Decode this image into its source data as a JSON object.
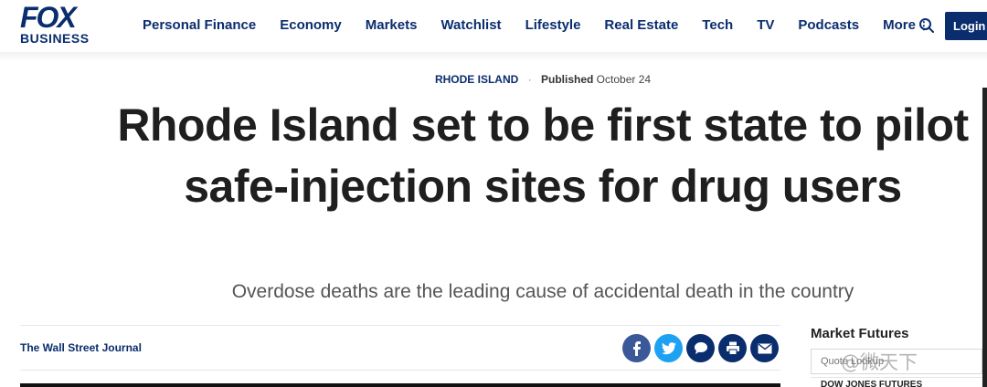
{
  "header": {
    "logo": {
      "top": "FOX",
      "bottom": "BUSINESS"
    },
    "nav": [
      "Personal Finance",
      "Economy",
      "Markets",
      "Watchlist",
      "Lifestyle",
      "Real Estate",
      "Tech",
      "TV",
      "Podcasts"
    ],
    "more_label": "More",
    "login_label": "Login",
    "icons": {
      "search": "search-icon",
      "more": "kebab-icon"
    }
  },
  "article": {
    "section": "RHODE ISLAND",
    "published_label": "Published",
    "published_date": "October 24",
    "headline": "Rhode Island set to be first state to pilot safe-injection sites for drug users",
    "subhead": "Overdose deaths are the leading cause of accidental death in the country",
    "source": "The Wall Street Journal",
    "share_icons": [
      "facebook-icon",
      "twitter-icon",
      "comments-icon",
      "print-icon",
      "email-icon"
    ]
  },
  "rail": {
    "title": "Market Futures",
    "quote_placeholder": "Quote Lookup",
    "first_row": "DOW JONES FUTURES"
  },
  "watermark": "@微天下",
  "colors": {
    "brand": "#0a2d6e",
    "facebook": "#3b5998",
    "twitter": "#1da1f2"
  }
}
